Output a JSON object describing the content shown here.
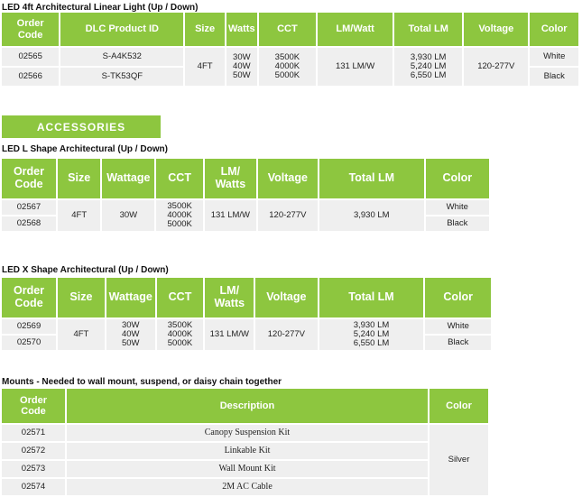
{
  "section1": {
    "title": "LED 4ft Architectural Linear Light (Up / Down)",
    "headers": [
      "Order\nCode",
      "DLC Product ID",
      "Size",
      "Watts",
      "CCT",
      "LM/Watt",
      "Total LM",
      "Voltage",
      "Color"
    ],
    "rows": [
      {
        "order": "02565",
        "dlc": "S-A4K532",
        "color": "White"
      },
      {
        "order": "02566",
        "dlc": "S-TK53QF",
        "color": "Black"
      }
    ],
    "size": "4FT",
    "watts": "30W\n40W\n50W",
    "cct": "3500K\n4000K\n5000K",
    "lm_watt": "131 LM/W",
    "total_lm": "3,930 LM\n5,240 LM\n6,550 LM",
    "voltage": "120-277V"
  },
  "accessories_label": "ACCESSORIES",
  "section2": {
    "title": "LED L Shape Architectural (Up / Down)",
    "headers": [
      "Order\nCode",
      "Size",
      "Wattage",
      "CCT",
      "LM/\nWatts",
      "Voltage",
      "Total LM",
      "Color"
    ],
    "rows": [
      {
        "order": "02567",
        "color": "White"
      },
      {
        "order": "02568",
        "color": "Black"
      }
    ],
    "size": "4FT",
    "wattage": "30W",
    "cct": "3500K\n4000K\n5000K",
    "lm_watts": "131 LM/W",
    "voltage": "120-277V",
    "total_lm": "3,930 LM"
  },
  "section3": {
    "title": "LED X Shape Architectural (Up / Down)",
    "headers": [
      "Order\nCode",
      "Size",
      "Wattage",
      "CCT",
      "LM/\nWatts",
      "Voltage",
      "Total LM",
      "Color"
    ],
    "rows": [
      {
        "order": "02569",
        "color": "White"
      },
      {
        "order": "02570",
        "color": "Black"
      }
    ],
    "size": "4FT",
    "wattage": "30W\n40W\n50W",
    "cct": "3500K\n4000K\n5000K",
    "lm_watts": "131 LM/W",
    "voltage": "120-277V",
    "total_lm": "3,930 LM\n5,240 LM\n6,550 LM"
  },
  "section4": {
    "title": "Mounts - Needed to wall mount, suspend, or daisy chain together",
    "headers": [
      "Order\nCode",
      "Description",
      "Color"
    ],
    "rows": [
      {
        "order": "02571",
        "description": "Canopy Suspension Kit"
      },
      {
        "order": "02572",
        "description": "Linkable Kit"
      },
      {
        "order": "02573",
        "description": "Wall Mount Kit"
      },
      {
        "order": "02574",
        "description": "2M AC Cable"
      }
    ],
    "color": "Silver"
  },
  "colors": {
    "header_green": "#8dc63f",
    "cell_gray": "#efefef",
    "header_text": "#ffffff"
  }
}
